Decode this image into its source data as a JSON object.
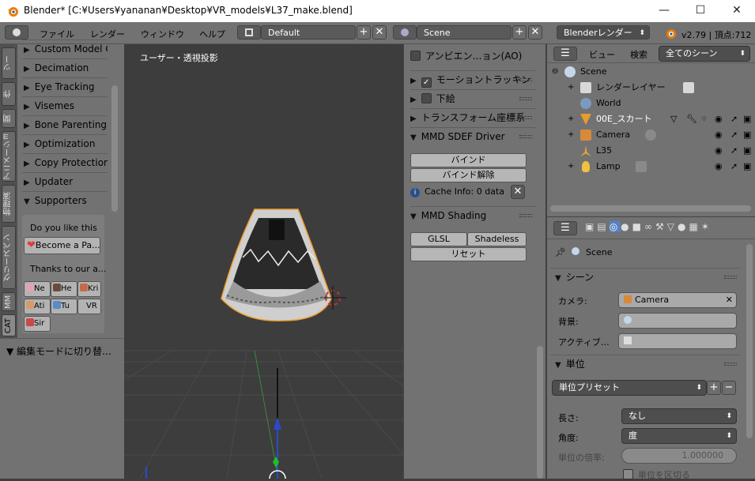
{
  "window": {
    "title": "Blender* [C:¥Users¥yananan¥Desktop¥VR_models¥L37_make.blend]",
    "minimize": "—",
    "maximize": "☐",
    "close": "✕"
  },
  "topbar": {
    "menus": [
      "ファイル",
      "レンダー",
      "ウィンドウ",
      "ヘルプ"
    ],
    "layout": "Default",
    "scene": "Scene",
    "engine": "Blenderレンダー",
    "version": "v2.79 | 頂点:712"
  },
  "left_tabs": [
    "ツー",
    "作",
    "関",
    "アニメーション",
    "物理演",
    "グリースペン",
    "MM",
    "CAT"
  ],
  "tool_panels": [
    "Custom Model Cr",
    "Decimation",
    "Eye Tracking",
    "Visemes",
    "Bone Parenting",
    "Optimization",
    "Copy Protection",
    "Updater",
    "Supporters"
  ],
  "supporters": {
    "question": "Do you like this",
    "patreon_button": "Become a Pa...",
    "thanks": "Thanks to our a...",
    "names": [
      "Ne",
      "He",
      "Kri",
      "Ati",
      "Tu",
      "VR",
      "Sir"
    ]
  },
  "edit_mode": "▼ 編集モードに切り替…",
  "viewport": {
    "label": "ユーザー・透視投影"
  },
  "n_panel": {
    "ao": "アンビエン…ョン(AO)",
    "motion": "モーショントラッキン",
    "base": "下絵",
    "transform": "トランスフォーム座標系",
    "sdef_title": "MMD SDEF Driver",
    "bind": "バインド",
    "unbind": "バインド解除",
    "cache_info": "Cache Info: 0 data",
    "shading_title": "MMD Shading",
    "glsl": "GLSL",
    "shadeless": "Shadeless",
    "reset": "リセット"
  },
  "outliner": {
    "view": "ビュー",
    "search": "検索",
    "filter": "全てのシーン",
    "items": [
      {
        "label": "Scene",
        "indent": 0,
        "icon": "scene-icon",
        "color": "#c6d6ea"
      },
      {
        "label": "レンダーレイヤー",
        "indent": 1,
        "icon": "render-layers-icon",
        "color": "#d8d8d8"
      },
      {
        "label": "World",
        "indent": 1,
        "icon": "world-icon",
        "color": "#7b9ac2"
      },
      {
        "label": "00E_スカート",
        "indent": 1,
        "icon": "mesh-icon",
        "color": "#e89b2c"
      },
      {
        "label": "Camera",
        "indent": 1,
        "icon": "camera-icon",
        "color": "#d8893a"
      },
      {
        "label": "L35",
        "indent": 1,
        "icon": "armature-icon",
        "color": "#e8a13a"
      },
      {
        "label": "Lamp",
        "indent": 1,
        "icon": "lamp-icon",
        "color": "#f0c040"
      }
    ]
  },
  "properties": {
    "breadcrumb": "Scene",
    "scene_section": "シーン",
    "camera_label": "カメラ:",
    "camera_value": "Camera",
    "bg_label": "背景:",
    "active_label": "アクティブ…",
    "units_section": "単位",
    "units_preset": "単位プリセット",
    "length_label": "長さ:",
    "length_value": "なし",
    "angle_label": "角度:",
    "angle_value": "度",
    "scale_label": "単位の倍率:",
    "scale_value": "1.000000",
    "separate_label": "単位を区切る"
  },
  "colors": {
    "accent_blue": "#5680c2",
    "selection_orange": "#f0a030"
  }
}
